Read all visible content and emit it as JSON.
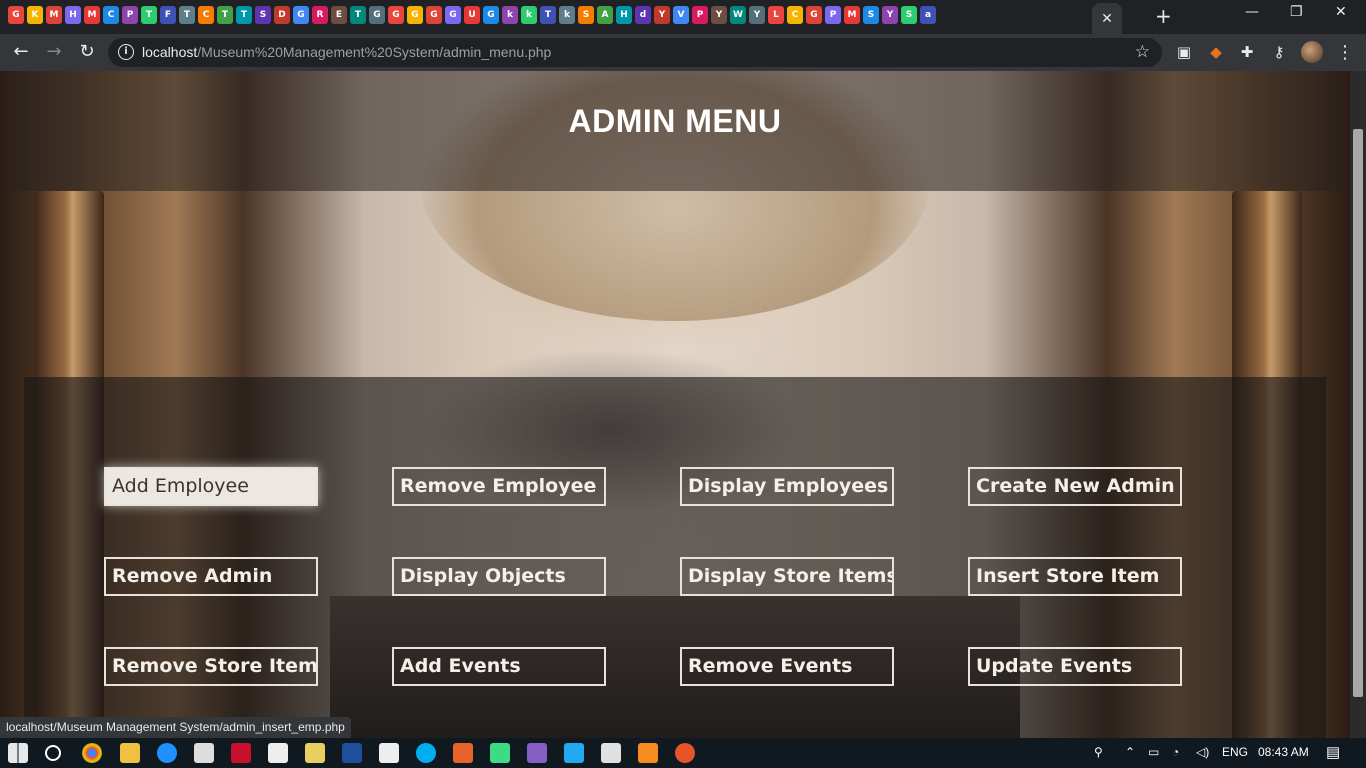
{
  "browser": {
    "address": {
      "host": "localhost",
      "path": "/Museum%20Management%20System/admin_menu.php"
    },
    "status_url": "localhost/Museum Management System/admin_insert_emp.php",
    "tab_favicons": [
      "G",
      "K",
      "M",
      "H",
      "M",
      "C",
      "P",
      "T",
      "F",
      "T",
      "C",
      "T",
      "T",
      "S",
      "D",
      "G",
      "R",
      "E",
      "T",
      "G",
      "G",
      "G",
      "G",
      "G",
      "U",
      "G",
      "k",
      "k",
      "T",
      "k",
      "S",
      "A",
      "H",
      "d",
      "Y",
      "V",
      "P",
      "Y",
      "W",
      "Y",
      "L",
      "C",
      "G",
      "P",
      "M",
      "S",
      "Y",
      "S",
      "a"
    ]
  },
  "page": {
    "title": "ADMIN MENU",
    "menu": [
      {
        "label": "Add Employee"
      },
      {
        "label": "Remove Employee"
      },
      {
        "label": "Display Employees"
      },
      {
        "label": "Create New Admin"
      },
      {
        "label": "Remove Admin"
      },
      {
        "label": "Display Objects"
      },
      {
        "label": "Display Store Items"
      },
      {
        "label": "Insert Store Item"
      },
      {
        "label": "Remove Store Item"
      },
      {
        "label": "Add Events"
      },
      {
        "label": "Remove Events"
      },
      {
        "label": "Update Events"
      }
    ]
  },
  "taskbar": {
    "language": "ENG",
    "time": "08:43 AM"
  }
}
